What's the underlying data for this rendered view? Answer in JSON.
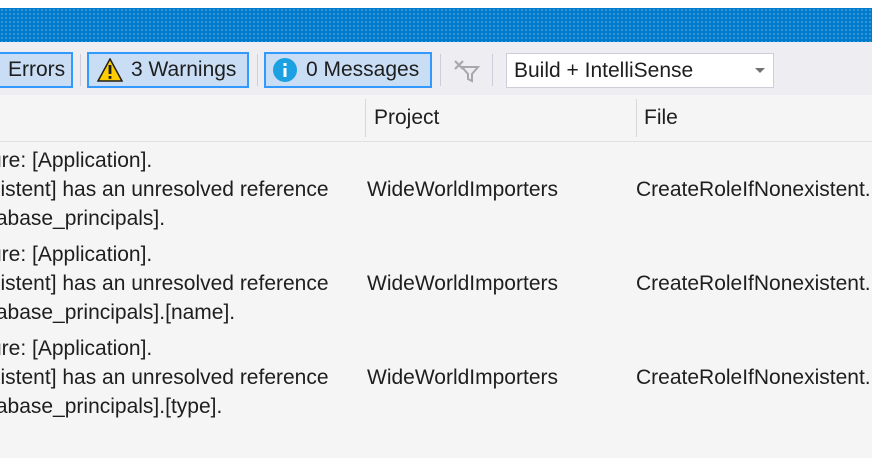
{
  "toolbar": {
    "errors_label": "Errors",
    "warnings_label": "3 Warnings",
    "messages_label": "0 Messages",
    "scope_value": "Build + IntelliSense"
  },
  "columns": {
    "project": "Project",
    "file": "File"
  },
  "rows": [
    {
      "line1": "ure: [Application].",
      "line2": "xistent] has an unresolved reference",
      "line3": "tabase_principals].",
      "project": "WideWorldImporters",
      "file": "CreateRoleIfNonexistent."
    },
    {
      "line1": "ure: [Application].",
      "line2": "xistent] has an unresolved reference",
      "line3": "tabase_principals].[name].",
      "project": "WideWorldImporters",
      "file": "CreateRoleIfNonexistent."
    },
    {
      "line1": "ure: [Application].",
      "line2": "xistent] has an unresolved reference",
      "line3": "tabase_principals].[type].",
      "project": "WideWorldImporters",
      "file": "CreateRoleIfNonexistent."
    }
  ],
  "colors": {
    "accent": "#007acc",
    "toggle_border": "#3399ff",
    "toggle_fill": "#c9def5",
    "warning": "#ffcc00",
    "info": "#1ba1e2"
  }
}
